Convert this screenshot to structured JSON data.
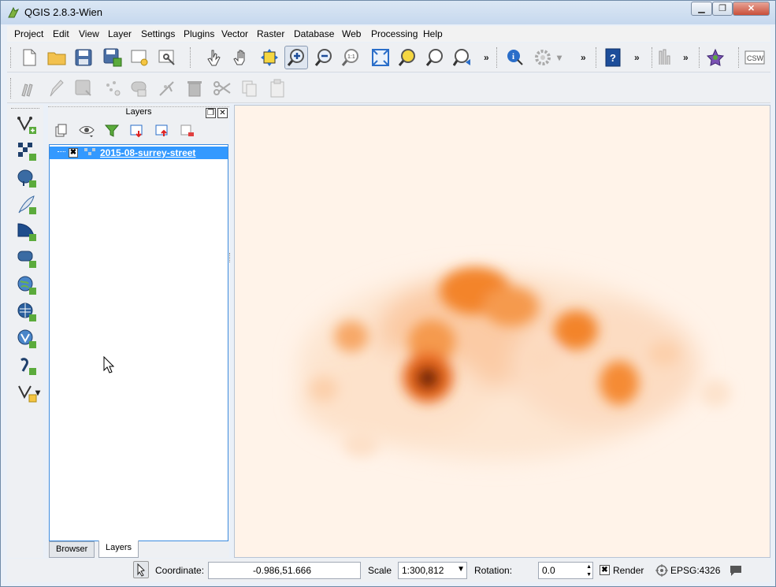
{
  "window": {
    "title": "QGIS 2.8.3-Wien"
  },
  "menubar": [
    "Project",
    "Edit",
    "View",
    "Layer",
    "Settings",
    "Plugins",
    "Vector",
    "Raster",
    "Database",
    "Web",
    "Processing",
    "Help"
  ],
  "toolbar_overflow": "»",
  "toolbar": {
    "csw_label": "CSW",
    "zoom_1to1_label": "1:1"
  },
  "layers_panel": {
    "title": "Layers",
    "layers": [
      {
        "name": "2015-08-surrey-street",
        "visible": true
      }
    ],
    "tabs": [
      "Browser",
      "Layers"
    ],
    "active_tab": "Layers"
  },
  "status": {
    "coordinate_label": "Coordinate:",
    "coordinate_value": "-0.986,51.666",
    "scale_label": "Scale",
    "scale_value": "1:300,812",
    "rotation_label": "Rotation:",
    "rotation_value": "0.0",
    "render_label": "Render",
    "render_checked": true,
    "crs": "EPSG:4326"
  },
  "colors": {
    "heat_low": "#fff3e9",
    "heat_mid": "#f27a23",
    "heat_high": "#5a1e06",
    "selection": "#3399ff"
  }
}
